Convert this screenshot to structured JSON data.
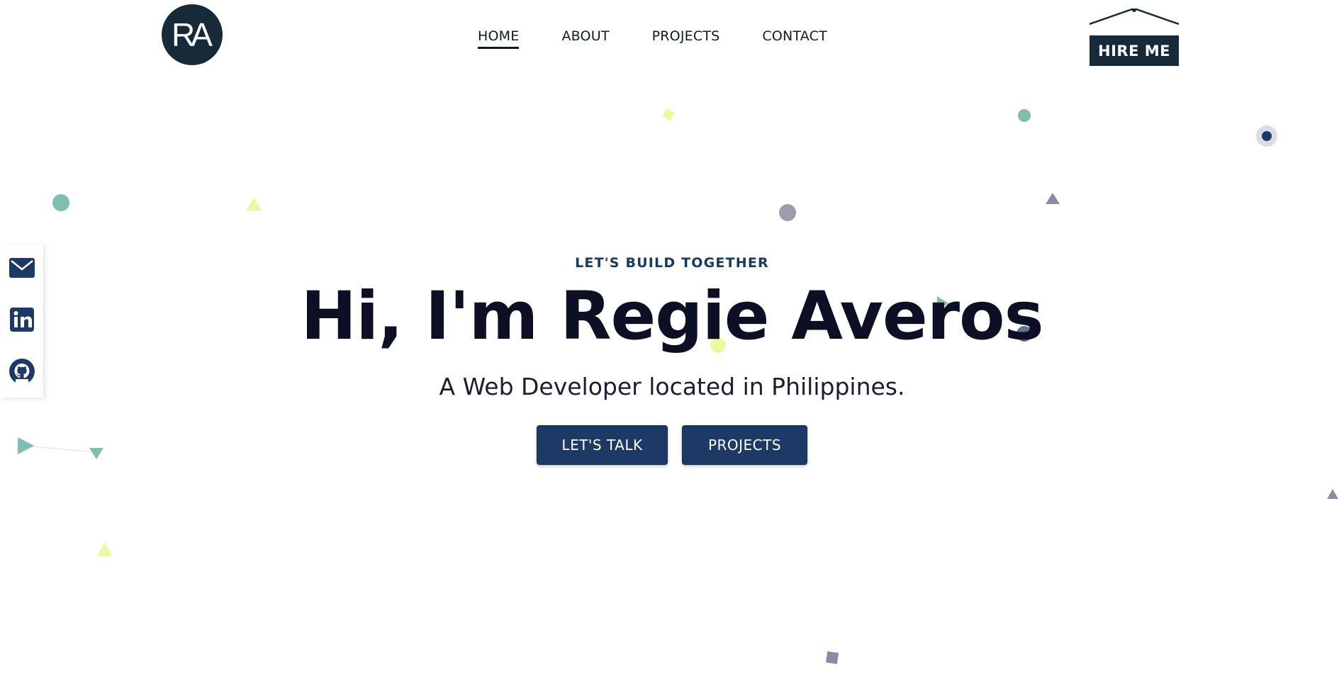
{
  "header": {
    "logo_text": "RA",
    "nav": [
      {
        "label": "HOME",
        "active": true
      },
      {
        "label": "ABOUT",
        "active": false
      },
      {
        "label": "PROJECTS",
        "active": false
      },
      {
        "label": "CONTACT",
        "active": false
      }
    ],
    "hire_me_label": "HIRE ME"
  },
  "social": {
    "items": [
      {
        "icon": "envelope-icon"
      },
      {
        "icon": "linkedin-icon"
      },
      {
        "icon": "github-icon"
      }
    ]
  },
  "hero": {
    "eyebrow": "LET'S BUILD TOGETHER",
    "title": "Hi, I'm Regie Averos",
    "subtitle": "A Web Developer located in Philippines.",
    "buttons": {
      "talk": "LET'S TALK",
      "projects": "PROJECTS"
    }
  },
  "colors": {
    "primary": "#1d3a66",
    "dark": "#172a3a",
    "accent_teal": "#7fbfb2",
    "accent_lime": "#eef8a0",
    "accent_gray": "#9c9bb0"
  }
}
